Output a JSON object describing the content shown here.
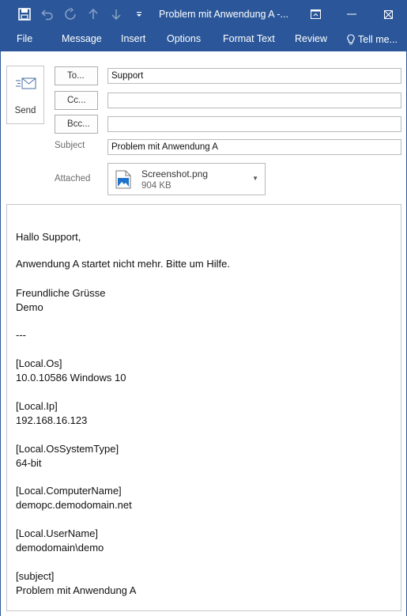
{
  "titlebar": {
    "title": "Problem mit Anwendung A -...",
    "icons": [
      "save-icon",
      "undo-icon",
      "redo-icon",
      "up-icon",
      "down-icon",
      "customize-icon",
      "ribbon-display-icon",
      "minimize-icon",
      "maximize-icon",
      "close-icon"
    ]
  },
  "ribbon": {
    "tabs": [
      "File",
      "Message",
      "Insert",
      "Options",
      "Format Text",
      "Review",
      "Tell me..."
    ]
  },
  "compose": {
    "send_label": "Send",
    "to_label": "To...",
    "cc_label": "Cc...",
    "bcc_label": "Bcc...",
    "to_value": "Support",
    "cc_value": "",
    "bcc_value": "",
    "subject_label": "Subject",
    "subject_value": "Problem mit Anwendung A",
    "attached_label": "Attached",
    "attachment": {
      "name": "Screenshot.png",
      "size": "904 KB"
    }
  },
  "body": {
    "lines": [
      "Hallo Support,",
      "Anwendung A startet nicht mehr. Bitte um Hilfe.",
      "Freundliche Grüsse",
      "Demo",
      "---",
      "[Local.Os]",
      "10.0.10586 Windows 10",
      "[Local.Ip]",
      "192.168.16.123",
      "[Local.OsSystemType]",
      "64-bit",
      "[Local.ComputerName]",
      "demopc.demodomain.net",
      "[Local.UserName]",
      "demodomain\\demo",
      "[subject]",
      "Problem mit Anwendung A"
    ]
  },
  "colors": {
    "accent": "#2b579a",
    "border": "#c6c6c6"
  }
}
